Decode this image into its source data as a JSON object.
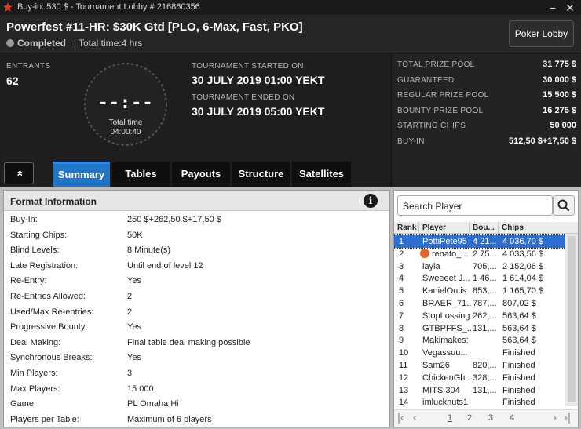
{
  "window": {
    "title": "Buy-in: 530 $ - Tournament Lobby # 216860356",
    "minimize_glyph": "−",
    "close_glyph": "✕"
  },
  "header": {
    "tournament_name": "Powerfest #11-HR: $30K Gtd [PLO, 6-Max, Fast, PKO]",
    "status": "Completed",
    "separator": "|",
    "total_time": "Total time:4 hrs",
    "lobby_button": "Poker Lobby"
  },
  "summary": {
    "entrants_label": "ENTRANTS",
    "entrants_value": "62",
    "clock_digits": "--:--",
    "clock_label": "Total time",
    "clock_value": "04:00:40",
    "started_label": "TOURNAMENT STARTED ON",
    "started_value": "30 JULY 2019  01:00 YEKT",
    "ended_label": "TOURNAMENT ENDED ON",
    "ended_value": "30 JULY 2019  05:00 YEKT"
  },
  "prizes": [
    {
      "label": "TOTAL PRIZE POOL",
      "value": "31 775 $"
    },
    {
      "label": "GUARANTEED",
      "value": "30 000 $"
    },
    {
      "label": "REGULAR PRIZE POOL",
      "value": "15 500 $"
    },
    {
      "label": "BOUNTY PRIZE POOL",
      "value": "16 275 $"
    },
    {
      "label": "STARTING CHIPS",
      "value": "50 000"
    },
    {
      "label": "BUY-IN",
      "value": "512,50 $+17,50 $"
    }
  ],
  "tabs": [
    {
      "label": "Summary",
      "active": true
    },
    {
      "label": "Tables",
      "active": false
    },
    {
      "label": "Payouts",
      "active": false
    },
    {
      "label": "Structure",
      "active": false
    },
    {
      "label": "Satellites",
      "active": false
    }
  ],
  "collapse_glyph": "»",
  "format": {
    "title": "Format Information",
    "info_glyph": "i",
    "rows": [
      {
        "key": "Buy-In:",
        "value": "250 $+262,50 $+17,50 $"
      },
      {
        "key": "Starting Chips:",
        "value": "50K"
      },
      {
        "key": "Blind Levels:",
        "value": "8 Minute(s)"
      },
      {
        "key": "Late Registration:",
        "value": "Until end of level 12"
      },
      {
        "key": "Re-Entry:",
        "value": "Yes"
      },
      {
        "key": "Re-Entries Allowed:",
        "value": "2"
      },
      {
        "key": "Used/Max Re-entries:",
        "value": "2"
      },
      {
        "key": "Progressive Bounty:",
        "value": "Yes"
      },
      {
        "key": "Deal Making:",
        "value": "Final table deal making possible"
      },
      {
        "key": "Synchronous Breaks:",
        "value": "Yes"
      },
      {
        "key": "Min Players:",
        "value": "3"
      },
      {
        "key": "Max Players:",
        "value": "15 000"
      },
      {
        "key": "Game:",
        "value": "PL Omaha Hi"
      },
      {
        "key": "Players per Table:",
        "value": "Maximum of 6 players"
      }
    ]
  },
  "players": {
    "search_placeholder": "Search Player",
    "columns": [
      "Rank",
      "Player",
      "Bou...",
      "Chips"
    ],
    "rows": [
      {
        "rank": "1",
        "player": "PottiPete95",
        "bounty": "4 21...",
        "chips": "4 036,70 $",
        "selected": true
      },
      {
        "rank": "2",
        "player": "renato_...",
        "bounty": "2 75...",
        "chips": "4 033,56 $",
        "badge": true
      },
      {
        "rank": "3",
        "player": "layla",
        "bounty": "705,...",
        "chips": "2 152,06 $"
      },
      {
        "rank": "4",
        "player": "Sweeeet J...",
        "bounty": "1 46...",
        "chips": "1 614,04 $"
      },
      {
        "rank": "5",
        "player": "KanielOutis",
        "bounty": "853,...",
        "chips": "1 165,70 $"
      },
      {
        "rank": "6",
        "player": "BRAER_71...",
        "bounty": "787,...",
        "chips": "807,02 $"
      },
      {
        "rank": "7",
        "player": "StopLossing",
        "bounty": "262,...",
        "chips": "563,64 $"
      },
      {
        "rank": "8",
        "player": "GTBPFFS_...",
        "bounty": "131,...",
        "chips": "563,64 $"
      },
      {
        "rank": "9",
        "player": "Makimakes:",
        "bounty": "",
        "chips": "563,64 $"
      },
      {
        "rank": "10",
        "player": "Vegassuu...",
        "bounty": "",
        "chips": "Finished"
      },
      {
        "rank": "11",
        "player": "Sam26",
        "bounty": "820,...",
        "chips": "Finished"
      },
      {
        "rank": "12",
        "player": "ChickenGh...",
        "bounty": "328,...",
        "chips": "Finished"
      },
      {
        "rank": "13",
        "player": "MITS 304",
        "bounty": "131,...",
        "chips": "Finished"
      },
      {
        "rank": "14",
        "player": "imlucknuts1",
        "bounty": "",
        "chips": "Finished"
      }
    ],
    "pager": {
      "first": "|‹",
      "prev": "‹",
      "pages": [
        "1",
        "2",
        "3",
        "4"
      ],
      "next": "›",
      "last": "›|"
    }
  },
  "colors": {
    "accent": "#1f76c8",
    "selected_row": "#2d6fd1",
    "background": "#1c1c1c"
  }
}
